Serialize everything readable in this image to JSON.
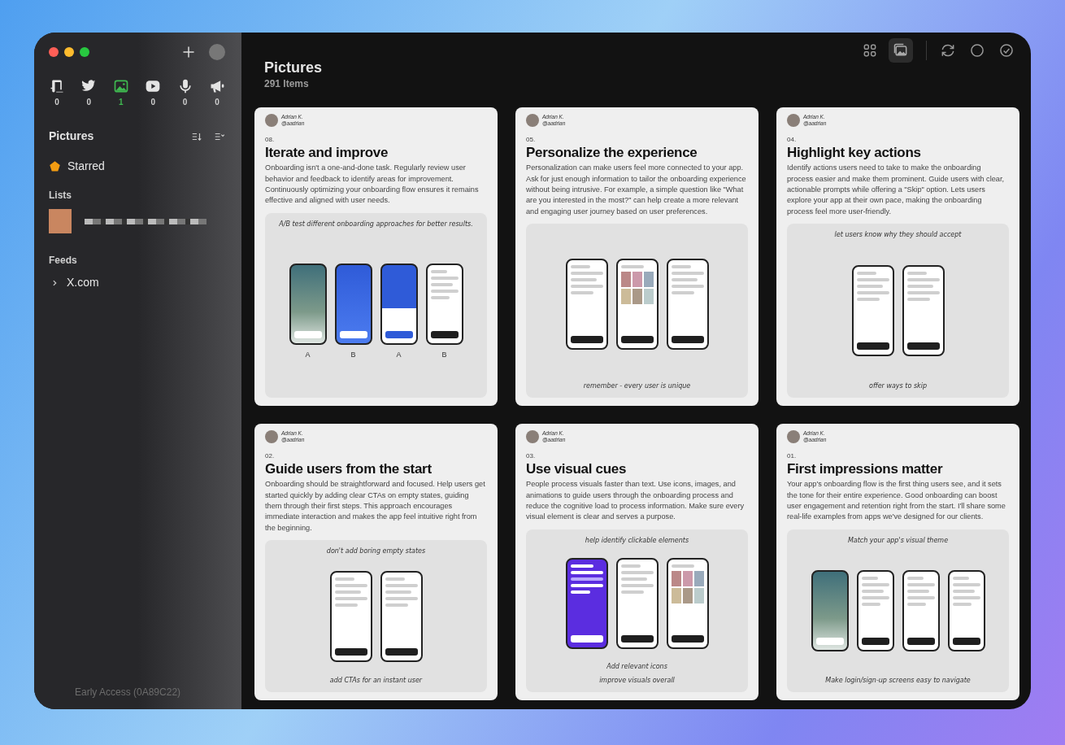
{
  "sidebar": {
    "sources": [
      {
        "count": "0",
        "selected": false
      },
      {
        "count": "0",
        "selected": false
      },
      {
        "count": "1",
        "selected": true
      },
      {
        "count": "0",
        "selected": false
      },
      {
        "count": "0",
        "selected": false
      },
      {
        "count": "0",
        "selected": false
      }
    ],
    "section_title": "Pictures",
    "starred": "Starred",
    "lists_title": "Lists",
    "feeds_title": "Feeds",
    "feeds": [
      {
        "label": "X.com",
        "expanded": false
      }
    ],
    "footer": "Early Access (0A89C22)"
  },
  "header": {
    "title": "Pictures",
    "count": "291 Items",
    "views": [
      {
        "selected": false
      },
      {
        "selected": true
      }
    ]
  },
  "cards": [
    {
      "author": "Adrian K.",
      "handle": "@aadrian",
      "number": "08.",
      "title": "Iterate and improve",
      "body": "Onboarding isn't a one-and-done task. Regularly review user behavior and feedback to identify areas for improvement. Continuously optimizing your onboarding flow ensures it remains effective and aligned with user needs.",
      "captions_top": [
        "A/B test different onboarding approaches for better results."
      ],
      "phones": [
        {
          "kind": "photo",
          "label": "A"
        },
        {
          "kind": "blue",
          "label": "B"
        },
        {
          "kind": "modal",
          "label": "A"
        },
        {
          "kind": "light",
          "label": "B"
        }
      ]
    },
    {
      "author": "Adrian K.",
      "handle": "@aadrian",
      "number": "05.",
      "title": "Personalize the experience",
      "body": "Personalization can make users feel more connected to your app. Ask for just enough information to tailor the onboarding experience without being intrusive. For example, a simple question like \"What are you interested in the most?\" can help create a more relevant and engaging user journey based on user preferences.",
      "phones": [
        {
          "kind": "light"
        },
        {
          "kind": "grid"
        },
        {
          "kind": "light"
        }
      ],
      "captions_bottom": [
        "remember - every user is unique"
      ]
    },
    {
      "author": "Adrian K.",
      "handle": "@aadrian",
      "number": "04.",
      "title": "Highlight key actions",
      "body": "Identify actions users need to take to make the onboarding process easier and make them prominent. Guide users with clear, actionable prompts while offering a \"Skip\" option. Lets users explore your app at their own pace, making the onboarding process feel more user-friendly.",
      "captions_top": [
        "let users know why they should accept"
      ],
      "phones": [
        {
          "kind": "light"
        },
        {
          "kind": "light"
        }
      ],
      "captions_bottom": [
        "offer ways to skip"
      ]
    },
    {
      "author": "Adrian K.",
      "handle": "@aadrian",
      "number": "02.",
      "title": "Guide users from the start",
      "body": "Onboarding should be straightforward and focused. Help users get started quickly by adding clear CTAs on empty states, guiding them through their first steps. This approach encourages immediate interaction and makes the app feel intuitive right from the beginning.",
      "captions_top": [
        "don't add boring empty states"
      ],
      "phones": [
        {
          "kind": "light"
        },
        {
          "kind": "light"
        }
      ],
      "captions_bottom": [
        "add CTAs for an instant user"
      ]
    },
    {
      "author": "Adrian K.",
      "handle": "@aadrian",
      "number": "03.",
      "title": "Use visual cues",
      "body": "People process visuals faster than text. Use icons, images, and animations to guide users through the onboarding process and reduce the cognitive load to process information. Make sure every visual element is clear and serves a purpose.",
      "captions_top": [
        "help identify clickable elements"
      ],
      "phones": [
        {
          "kind": "purple"
        },
        {
          "kind": "light"
        },
        {
          "kind": "grid"
        }
      ],
      "captions_bottom": [
        "Add relevant icons",
        "improve visuals overall"
      ]
    },
    {
      "author": "Adrian K.",
      "handle": "@aadrian",
      "number": "01.",
      "title": "First impressions matter",
      "body": "Your app's onboarding flow is the first thing users see, and it sets the tone for their entire experience. Good onboarding can boost user engagement and retention right from the start. I'll share some real-life examples from apps we've designed for our clients.",
      "captions_top": [
        "Match your app's visual theme"
      ],
      "phones": [
        {
          "kind": "photo"
        },
        {
          "kind": "light"
        },
        {
          "kind": "light"
        },
        {
          "kind": "light"
        }
      ],
      "captions_bottom": [
        "Make login/sign-up screens easy to navigate"
      ]
    }
  ]
}
